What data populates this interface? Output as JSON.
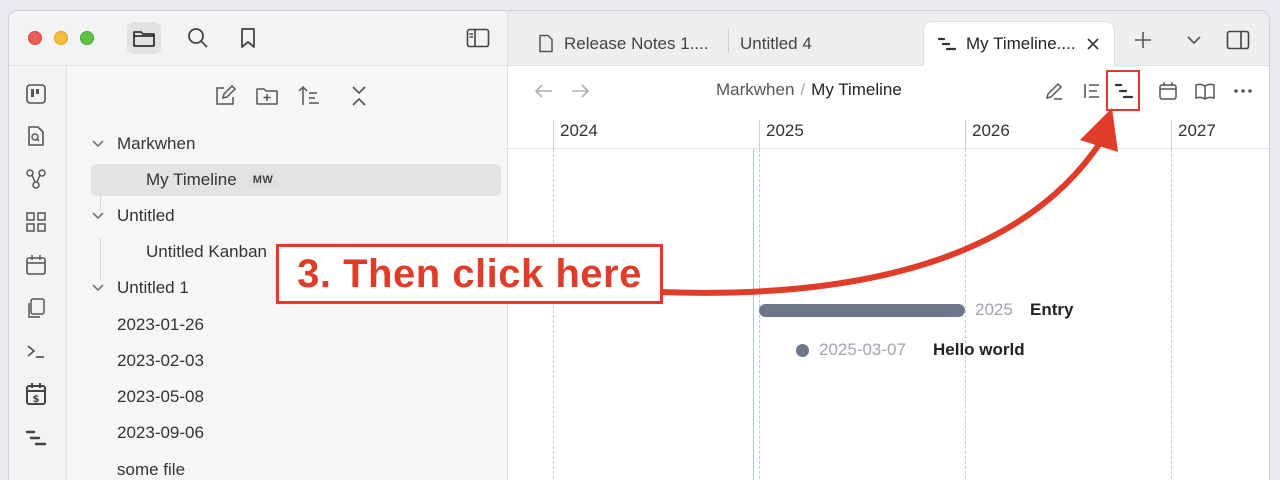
{
  "toolbar": {
    "files_icon": "folder-icon",
    "search_icon": "search-icon",
    "bookmark_icon": "bookmark-icon",
    "sidebar_toggle_icon": "sidebar-toggle-icon"
  },
  "ribbon": [
    "kanban-icon",
    "file-search-icon",
    "graph-icon",
    "dashboard-icon",
    "calendar-icon",
    "copy-icon",
    "terminal-icon",
    "calendar-dollar-icon",
    "timeline-icon"
  ],
  "explorer": {
    "tools": [
      "new-note-icon",
      "new-folder-icon",
      "sort-icon",
      "collapse-icon"
    ],
    "tree": [
      {
        "label": "Markwhen",
        "type": "folder"
      },
      {
        "label": "My Timeline",
        "type": "file",
        "badge": "MW",
        "selected": true
      },
      {
        "label": "Untitled",
        "type": "folder"
      },
      {
        "label": "Untitled Kanban",
        "type": "file"
      },
      {
        "label": "Untitled 1",
        "type": "folder"
      },
      {
        "label": "2023-01-26",
        "type": "file"
      },
      {
        "label": "2023-02-03",
        "type": "file"
      },
      {
        "label": "2023-05-08",
        "type": "file"
      },
      {
        "label": "2023-09-06",
        "type": "file"
      },
      {
        "label": "some file",
        "type": "file"
      }
    ]
  },
  "tabs": [
    {
      "label": "Release Notes 1....",
      "active": false
    },
    {
      "label": "Untitled 4",
      "active": false
    },
    {
      "label": "My Timeline....",
      "active": true
    }
  ],
  "breadcrumb": {
    "parent": "Markwhen",
    "separator": "/",
    "current": "My Timeline"
  },
  "timeline": {
    "years": [
      "2024",
      "2025",
      "2026",
      "2027"
    ],
    "events": [
      {
        "date": "2025",
        "title": "Entry",
        "kind": "range"
      },
      {
        "date": "2025-03-07",
        "title": "Hello world",
        "kind": "point"
      }
    ]
  },
  "annotation": {
    "text": "3. Then click here",
    "color": "#e03c2a"
  }
}
